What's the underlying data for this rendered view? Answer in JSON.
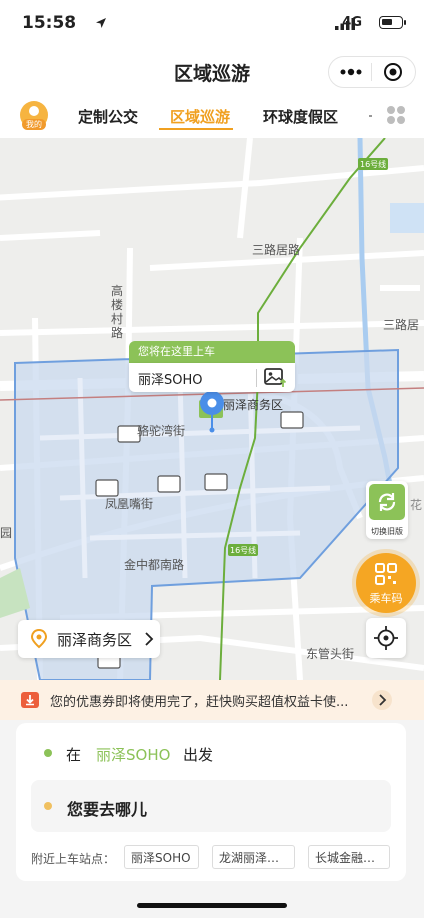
{
  "status_bar": {
    "time": "15:58",
    "network": "4G"
  },
  "nav": {
    "title": "区域巡游"
  },
  "tabs": {
    "avatar_label": "我的",
    "items": [
      {
        "label": "定制公交"
      },
      {
        "label": "区域巡游",
        "active": true
      },
      {
        "label": "环球度假区"
      }
    ]
  },
  "map": {
    "labels": {
      "road_sanluju": "三路居路",
      "road_gaolou_1": "高",
      "road_gaolou_2": "楼",
      "road_gaolou_3": "村",
      "road_gaolou_4": "路",
      "road_sanlujuR": "三路居",
      "road_luotuowan": "骆驼湾街",
      "road_fenghuangzui": "凤凰嘴街",
      "road_jinzhongdunan": "金中都南路",
      "road_dongguantou": "东管头街",
      "line16_top": "16号线",
      "line16_mid": "16号线",
      "lize_cbd": "丽泽商务区",
      "edge_top": "",
      "edge_left": "园",
      "edge_right": "花"
    },
    "pickup": {
      "header": "您将在这里上车",
      "station": "丽泽SOHO"
    },
    "switch_label": "切换旧版",
    "qr_label": "乘车码",
    "area_name": "丽泽商务区"
  },
  "coupon": {
    "text": "您的优惠券即将使用完了，赶快购买超值权益卡使..."
  },
  "trip": {
    "from_prefix": "在",
    "from_station": "丽泽SOHO",
    "from_suffix": "出发",
    "to_placeholder": "您要去哪儿",
    "nearby_label": "附近上车站点：",
    "nearby": [
      "丽泽SOHO",
      "龙湖丽泽…",
      "长城金融…"
    ]
  },
  "colors": {
    "accent": "#f0a020",
    "green": "#8cc258",
    "zone_fill": "#c9d9ef",
    "zone_stroke": "#6f9fde"
  }
}
